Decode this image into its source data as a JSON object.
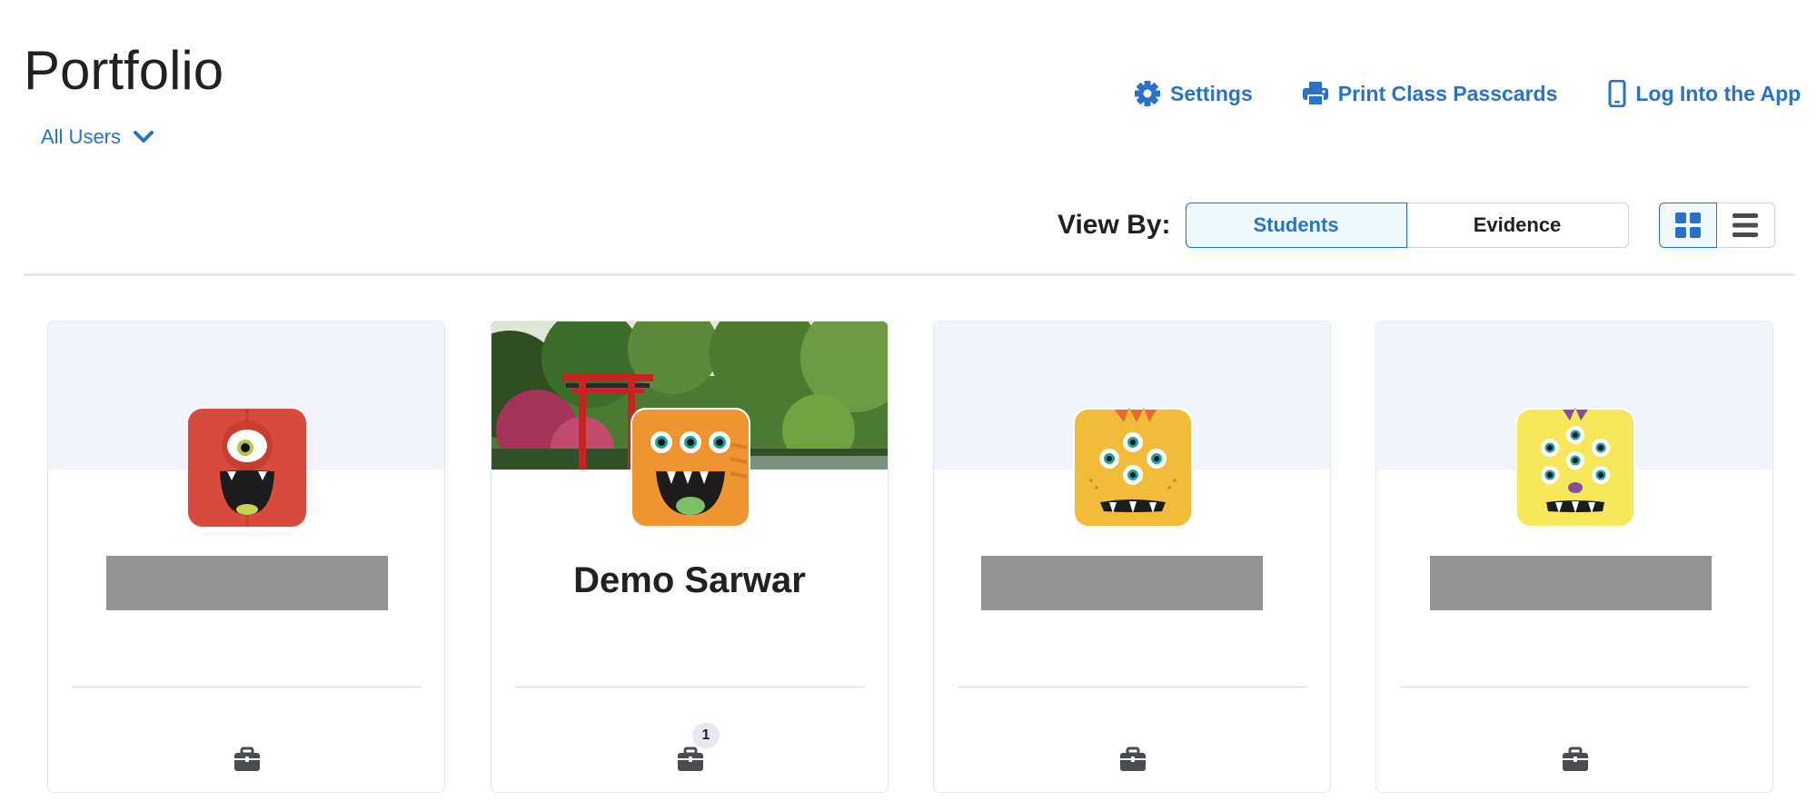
{
  "header": {
    "title": "Portfolio",
    "user_filter": "All Users",
    "actions": {
      "settings": "Settings",
      "print": "Print Class Passcards",
      "login": "Log Into the App"
    }
  },
  "view_by": {
    "label": "View By:",
    "options": [
      "Students",
      "Evidence"
    ],
    "selected": "Students",
    "layout": "grid"
  },
  "colors": {
    "accent": "#2872c8",
    "redacted": "#939393",
    "banner": "#f1f5fb"
  },
  "cards": [
    {
      "name": "",
      "avatar": "red-one-eyed-monster-icon",
      "banner": "plain",
      "redacted": true,
      "evidence_count": ""
    },
    {
      "name": "Demo Sarwar",
      "avatar": "orange-three-eyed-monster-icon",
      "banner": "japanese-garden-photo",
      "redacted": false,
      "evidence_count": "1"
    },
    {
      "name": "",
      "avatar": "yellow-four-eyed-monster-icon",
      "banner": "plain",
      "redacted": true,
      "evidence_count": ""
    },
    {
      "name": "",
      "avatar": "yellow-five-eyed-monster-icon",
      "banner": "plain",
      "redacted": true,
      "evidence_count": ""
    }
  ]
}
